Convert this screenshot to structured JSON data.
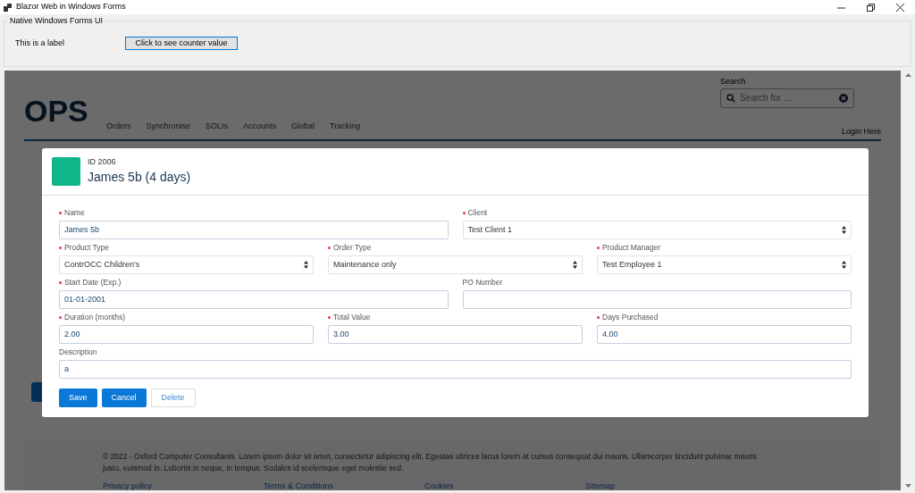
{
  "window": {
    "title": "Blazor Web in Windows Forms"
  },
  "native_group": {
    "title": "Native Windows Forms UI",
    "label": "This is a label",
    "button": "Click to see counter value"
  },
  "site": {
    "logo": "OPS",
    "nav": [
      {
        "label": "Orders"
      },
      {
        "label": "Synchronise"
      },
      {
        "label": "SOLIs"
      },
      {
        "label": "Accounts"
      },
      {
        "label": "Global"
      },
      {
        "label": "Tracking"
      }
    ],
    "search": {
      "label": "Search",
      "placeholder": "Search for ..."
    },
    "login": "Login Here",
    "footer": {
      "text": "© 2022 - Oxford Computer Consultants. Lorem ipsum dolor sit amet, consectetur adipiscing elit. Egestas ultrices lacus lorem at cursus consequat dui mauris. Ullamcorper tincidunt pulvinar mauris justo, euismod in. Lobortis in neque, in tempus. Sodales id scelerisque eget molestie sed.",
      "links": [
        "Privacy policy",
        "Terms & Conditions",
        "Cookies",
        "Sitemap"
      ]
    }
  },
  "dialog": {
    "id": "ID 2006",
    "title": "James 5b (4 days)",
    "color": "#10b68a",
    "rows": [
      [
        {
          "label": "Name",
          "required": true,
          "kind": "text",
          "value": "James 5b"
        },
        {
          "label": "Client",
          "required": true,
          "kind": "select",
          "value": "Test Client 1"
        }
      ],
      [
        {
          "label": "Product Type",
          "required": true,
          "kind": "select",
          "value": "ContrOCC Children's"
        },
        {
          "label": "Order Type",
          "required": true,
          "kind": "select",
          "value": "Maintenance only"
        },
        {
          "label": "Product Manager",
          "required": true,
          "kind": "select",
          "value": "Test Employee 1"
        }
      ],
      [
        {
          "label": "Start Date (Exp.)",
          "required": true,
          "kind": "text",
          "value": "01-01-2001"
        },
        {
          "label": "PO Number",
          "required": false,
          "kind": "text"
        }
      ],
      [
        {
          "label": "Duration (months)",
          "required": true,
          "kind": "text",
          "value": "2.00"
        },
        {
          "label": "Total Value",
          "required": true,
          "kind": "text",
          "value": "3.00"
        },
        {
          "label": "Days Purchased",
          "required": true,
          "kind": "text",
          "value": "4.00"
        }
      ],
      [
        {
          "label": "Description",
          "required": false,
          "kind": "text",
          "value": "a"
        }
      ]
    ],
    "buttons": [
      {
        "label": "Save",
        "kind": "primary"
      },
      {
        "label": "Cancel",
        "kind": "primary"
      },
      {
        "label": "Delete",
        "kind": "secondary"
      }
    ]
  }
}
